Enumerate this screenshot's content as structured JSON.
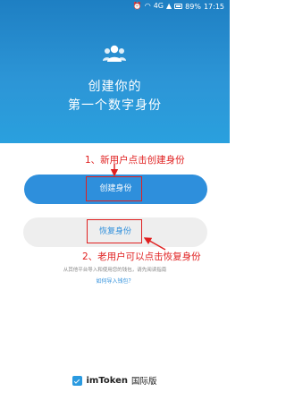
{
  "status_bar": {
    "signal_label": "4G",
    "battery": "89%",
    "time": "17:15"
  },
  "hero": {
    "title_line1": "创建你的",
    "title_line2": "第一个数字身份",
    "icon": "users-icon",
    "colors": {
      "top": "#1e7fc3",
      "bottom": "#2aa0de"
    }
  },
  "annotations": {
    "note1": "1、新用户点击创建身份",
    "note2": "2、老用户可以点击恢复身份",
    "color": "#e02020"
  },
  "buttons": {
    "create_label": "创建身份",
    "restore_label": "恢复身份"
  },
  "hint": {
    "text": "从其他平台导入和使用您的钱包，请先阅读指南",
    "link": "如何导入钱包？"
  },
  "brand": {
    "name": "imToken",
    "suffix": "国际版"
  }
}
